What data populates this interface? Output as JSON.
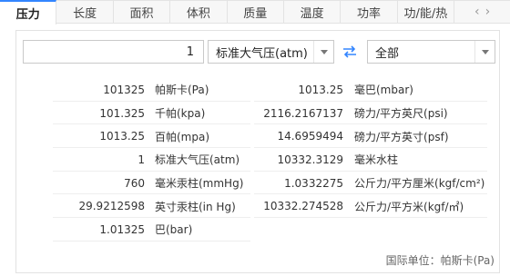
{
  "tabs": [
    "压力",
    "长度",
    "面积",
    "体积",
    "质量",
    "温度",
    "功率",
    "功/能/热"
  ],
  "active_tab": 0,
  "input": {
    "value": "1"
  },
  "from_unit": "标准大气压(atm)",
  "to_unit": "全部",
  "results": [
    {
      "left_value": "101325",
      "left_unit": "帕斯卡(Pa)",
      "right_value": "1013.25",
      "right_unit": "毫巴(mbar)"
    },
    {
      "left_value": "101.325",
      "left_unit": "千帕(kpa)",
      "right_value": "2116.2167137",
      "right_unit": "磅力/平方英尺(psi)"
    },
    {
      "left_value": "1013.25",
      "left_unit": "百帕(mpa)",
      "right_value": "14.6959494",
      "right_unit": "磅力/平方英寸(psf)"
    },
    {
      "left_value": "1",
      "left_unit": "标准大气压(atm)",
      "right_value": "10332.3129",
      "right_unit": "毫米水柱"
    },
    {
      "left_value": "760",
      "left_unit": "毫米汞柱(mmHg)",
      "right_value": "1.0332275",
      "right_unit": "公斤力/平方厘米(kgf/cm²)"
    },
    {
      "left_value": "29.9212598",
      "left_unit": "英寸汞柱(in Hg)",
      "right_value": "10332.274528",
      "right_unit": "公斤力/平方米(kgf/㎡)"
    },
    {
      "left_value": "1.01325",
      "left_unit": "巴(bar)",
      "right_value": "",
      "right_unit": ""
    }
  ],
  "footer": "国际单位：帕斯卡(Pa)",
  "icons": {
    "swap": "swap-arrows-icon",
    "prev": "chevron-left-icon",
    "next": "chevron-right-icon",
    "dropdown": "triangle-down-icon"
  },
  "colors": {
    "accent": "#3385ff",
    "border": "#c9c9c9",
    "tab_bg": "#f7f7f7"
  }
}
